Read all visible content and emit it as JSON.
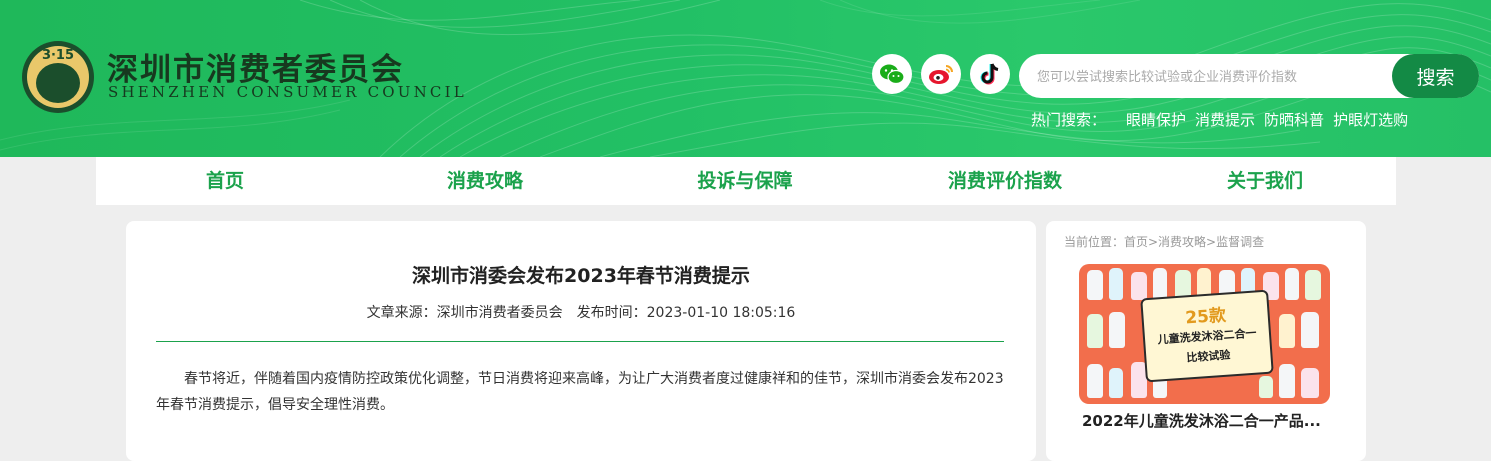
{
  "header": {
    "logo_title": "深圳市消费者委员会",
    "logo_subtitle": "SHENZHEN CONSUMER COUNCIL",
    "logo_emblem_text": "3·15",
    "social_icons": [
      "wechat-icon",
      "weibo-icon",
      "tiktok-icon"
    ],
    "search": {
      "placeholder": "您可以尝试搜索比较试验或企业消费评价指数",
      "button_label": "搜索"
    },
    "hot_search": {
      "label": "热门搜索：",
      "items": [
        "眼睛保护",
        "消费提示",
        "防晒科普",
        "护眼灯选购"
      ]
    },
    "colors": {
      "header_green": "#22c065",
      "search_button": "#138a45",
      "nav_text": "#1ba24c"
    }
  },
  "nav": {
    "items": [
      "首页",
      "消费攻略",
      "投诉与保障",
      "消费评价指数",
      "关于我们"
    ]
  },
  "article": {
    "title": "深圳市消委会发布2023年春节消费提示",
    "source_label": "文章来源：",
    "source": "深圳市消费者委员会",
    "time_label": "发布时间：",
    "time": "2023-01-10 18:05:16",
    "body": "春节将近，伴随着国内疫情防控政策优化调整，节日消费将迎来高峰，为让广大消费者度过健康祥和的佳节，深圳市消委会发布2023年春节消费提示，倡导安全理性消费。"
  },
  "sidebar": {
    "breadcrumb": "当前位置：首页>消费攻略>监督调查",
    "thumb": {
      "count": "25款",
      "line1": "儿童洗发沐浴二合一",
      "line2": "比较试验"
    },
    "feature_title": "2022年儿童洗发沐浴二合一产品..."
  }
}
